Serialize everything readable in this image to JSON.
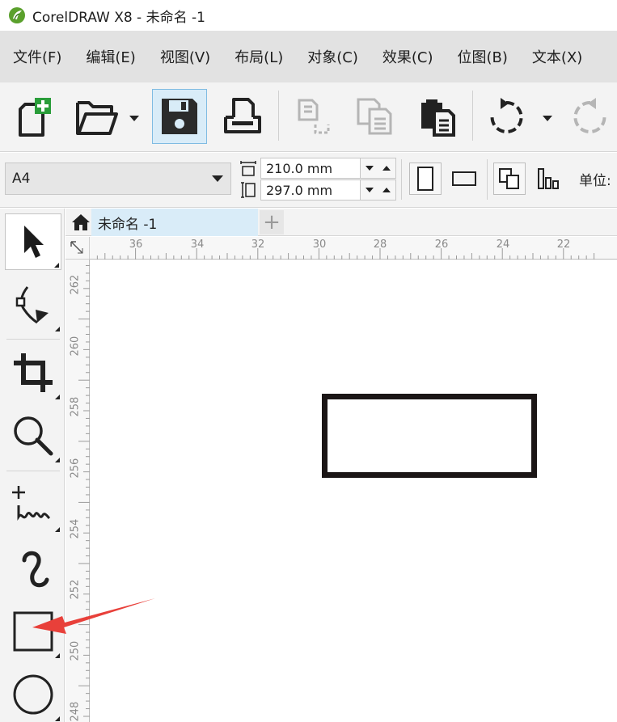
{
  "window": {
    "title": "CorelDRAW X8 - 未命名 -1"
  },
  "menu": [
    {
      "label": "文件(F)"
    },
    {
      "label": "编辑(E)"
    },
    {
      "label": "视图(V)"
    },
    {
      "label": "布局(L)"
    },
    {
      "label": "对象(C)"
    },
    {
      "label": "效果(C)"
    },
    {
      "label": "位图(B)"
    },
    {
      "label": "文本(X)"
    }
  ],
  "toolbar": {
    "buttons": [
      {
        "icon": "new-document-icon"
      },
      {
        "icon": "open-folder-icon"
      },
      {
        "icon": "save-icon",
        "active": true
      },
      {
        "icon": "print-icon"
      },
      {
        "icon": "cut-icon",
        "disabled": true
      },
      {
        "icon": "copy-icon",
        "disabled": true
      },
      {
        "icon": "paste-icon"
      },
      {
        "icon": "undo-icon"
      },
      {
        "icon": "redo-icon",
        "disabled": true
      }
    ]
  },
  "property_bar": {
    "page_size": "A4",
    "width": "210.0 mm",
    "height": "297.0 mm",
    "units_label": "单位:"
  },
  "document_tabs": {
    "active_tab": "未命名 -1",
    "new_tab_glyph": "+"
  },
  "rulers": {
    "horizontal_labels": [
      "36",
      "34",
      "32",
      "30",
      "28",
      "26",
      "24",
      "22"
    ],
    "vertical_labels": [
      "262",
      "260",
      "258",
      "256",
      "254",
      "252",
      "250",
      "248"
    ]
  },
  "toolbox": {
    "tools": [
      {
        "icon": "pick-tool-icon",
        "active": true
      },
      {
        "icon": "shape-tool-icon"
      },
      {
        "icon": "crop-tool-icon"
      },
      {
        "icon": "zoom-tool-icon"
      },
      {
        "icon": "freehand-tool-icon"
      },
      {
        "icon": "artistic-media-tool-icon"
      },
      {
        "icon": "rectangle-tool-icon"
      },
      {
        "icon": "ellipse-tool-icon"
      }
    ]
  },
  "colors": {
    "menu_bg": "#e2e2e2",
    "toolbar_bg": "#f3f3f3",
    "active_highlight": "#d9ecf8",
    "annotation_arrow": "#e8403a",
    "shape_stroke": "#1b1616"
  }
}
